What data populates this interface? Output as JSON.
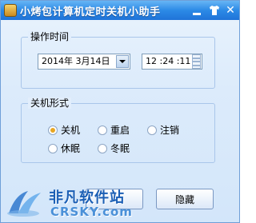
{
  "window": {
    "title": "小烤包计算机定时关机小助手"
  },
  "time_group": {
    "title": "操作时间",
    "date_value": "2014年 3月14日",
    "time_value": "12 :24 :11"
  },
  "mode_group": {
    "title": "关机形式",
    "options": [
      {
        "label": "关机",
        "checked": true
      },
      {
        "label": "重启",
        "checked": false
      },
      {
        "label": "注销",
        "checked": false
      },
      {
        "label": "休眠",
        "checked": false
      },
      {
        "label": "冬眠",
        "checked": false
      }
    ]
  },
  "buttons": {
    "right_label": "隐藏"
  },
  "watermark": {
    "cn": "非凡软件站",
    "en": "CRSKY.com"
  },
  "colors": {
    "title_bar": "#2c8ae6",
    "accent_radio": "#e7a622",
    "watermark": "#1b5fb5"
  }
}
